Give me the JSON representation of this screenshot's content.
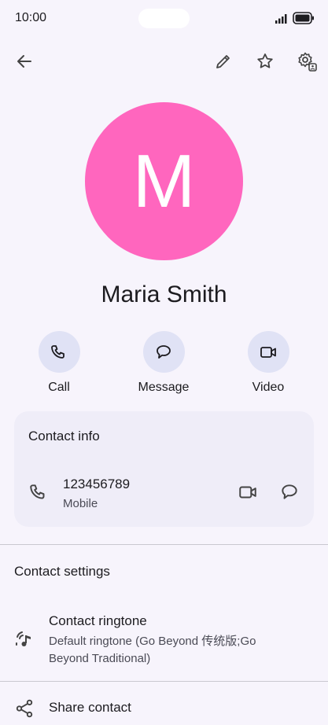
{
  "status_bar": {
    "time": "10:00"
  },
  "toolbar": {
    "back_icon": "arrow-back-icon",
    "edit_icon": "pencil-icon",
    "favorite_icon": "star-outline-icon",
    "settings_icon": "gear-person-icon"
  },
  "contact": {
    "initial": "M",
    "name": "Maria Smith",
    "avatar_color": "#ff66be"
  },
  "actions": [
    {
      "label": "Call",
      "icon": "phone-icon"
    },
    {
      "label": "Message",
      "icon": "message-bubble-icon"
    },
    {
      "label": "Video",
      "icon": "video-camera-icon"
    }
  ],
  "contact_info": {
    "title": "Contact info",
    "phone_number": "123456789",
    "phone_type": "Mobile"
  },
  "contact_settings": {
    "title": "Contact settings",
    "ringtone_label": "Contact ringtone",
    "ringtone_value": "Default ringtone (Go Beyond 传统版;Go Beyond Traditional)"
  },
  "share": {
    "label": "Share contact"
  },
  "colors": {
    "background": "#f7f4fc",
    "action_circle": "#e0e2f5",
    "card": "#efedf8"
  }
}
